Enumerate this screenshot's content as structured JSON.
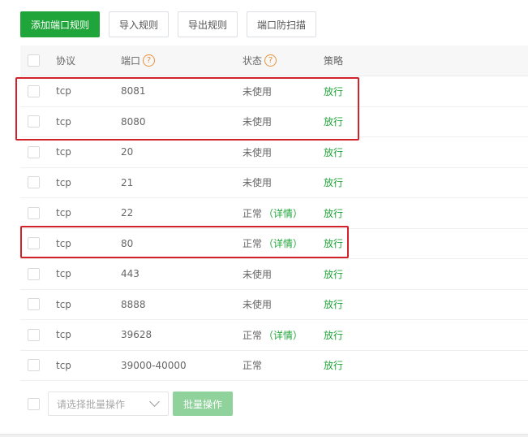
{
  "toolbar": {
    "add_rule": "添加端口规则",
    "import_rules": "导入规则",
    "export_rules": "导出规则",
    "port_scan_protect": "端口防扫描"
  },
  "table": {
    "headers": {
      "protocol": "协议",
      "port": "端口",
      "status": "状态",
      "policy": "策略"
    },
    "help_glyph": "?",
    "detail_label": "（详情）",
    "rows": [
      {
        "protocol": "tcp",
        "port": "8081",
        "status": "未使用",
        "detail": "",
        "policy": "放行"
      },
      {
        "protocol": "tcp",
        "port": "8080",
        "status": "未使用",
        "detail": "",
        "policy": "放行"
      },
      {
        "protocol": "tcp",
        "port": "20",
        "status": "未使用",
        "detail": "",
        "policy": "放行"
      },
      {
        "protocol": "tcp",
        "port": "21",
        "status": "未使用",
        "detail": "",
        "policy": "放行"
      },
      {
        "protocol": "tcp",
        "port": "22",
        "status": "正常",
        "detail": "（详情）",
        "policy": "放行"
      },
      {
        "protocol": "tcp",
        "port": "80",
        "status": "正常",
        "detail": "（详情）",
        "policy": "放行"
      },
      {
        "protocol": "tcp",
        "port": "443",
        "status": "未使用",
        "detail": "",
        "policy": "放行"
      },
      {
        "protocol": "tcp",
        "port": "8888",
        "status": "未使用",
        "detail": "",
        "policy": "放行"
      },
      {
        "protocol": "tcp",
        "port": "39628",
        "status": "正常",
        "detail": "（详情）",
        "policy": "放行"
      },
      {
        "protocol": "tcp",
        "port": "39000-40000",
        "status": "正常",
        "detail": "",
        "policy": "放行"
      }
    ]
  },
  "footer": {
    "batch_select_placeholder": "请选择批量操作",
    "batch_button": "批量操作"
  },
  "colors": {
    "brand_green": "#20a53a",
    "disabled_green": "#90d29c",
    "highlight_red": "#d2232a",
    "help_orange": "#e8913b"
  },
  "icons": {
    "help": "question-circle-icon",
    "dropdown": "chevron-down-icon"
  }
}
